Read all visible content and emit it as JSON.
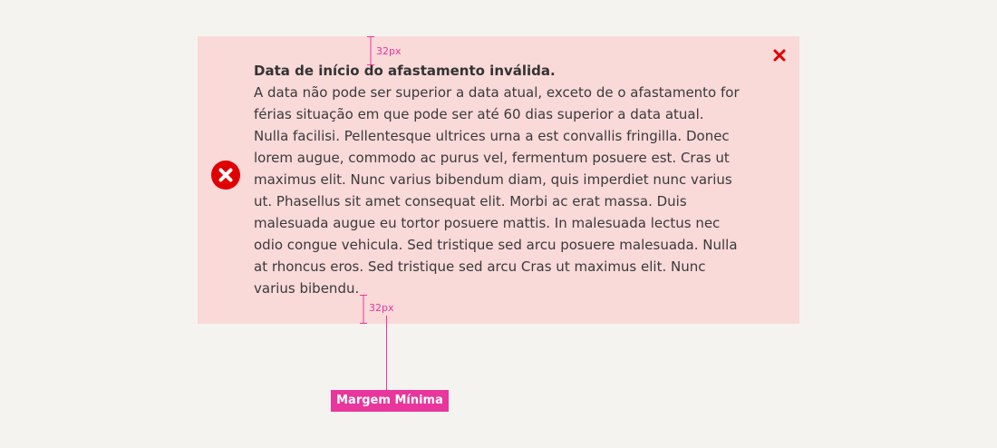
{
  "alert": {
    "title": "Data de início do afastamento inválida.",
    "body": "A data não pode ser superior a data atual, exceto de o afastamento for férias situação em que pode ser até 60 dias superior a data atual. Nulla facilisi. Pellentesque ultrices urna a est convallis fringilla. Donec lorem augue, commodo ac purus vel, fermentum posuere est. Cras ut maximus elit. Nunc varius bibendum diam, quis imperdiet nunc varius ut. Phasellus sit amet consequat elit. Morbi ac erat massa. Duis malesuada augue eu tortor posuere mattis. In malesuada lectus nec odio congue vehicula. Sed tristique sed arcu posuere malesuada. Nulla at rhoncus eros. Sed tristique sed arcu Cras ut maximus elit. Nunc varius bibendu.",
    "leading_icon": "error-circle-x-icon",
    "close_icon": "close-x-icon"
  },
  "annotations": {
    "top_spacing_label": "32px",
    "bottom_spacing_label": "32px",
    "margin_label": "Margem Mínima"
  },
  "colors": {
    "page_background": "#f4f3f0",
    "alert_background": "#fad9d9",
    "error_red": "#e00000",
    "annotation_pink": "#e8369c",
    "text": "#3a3a3a"
  }
}
